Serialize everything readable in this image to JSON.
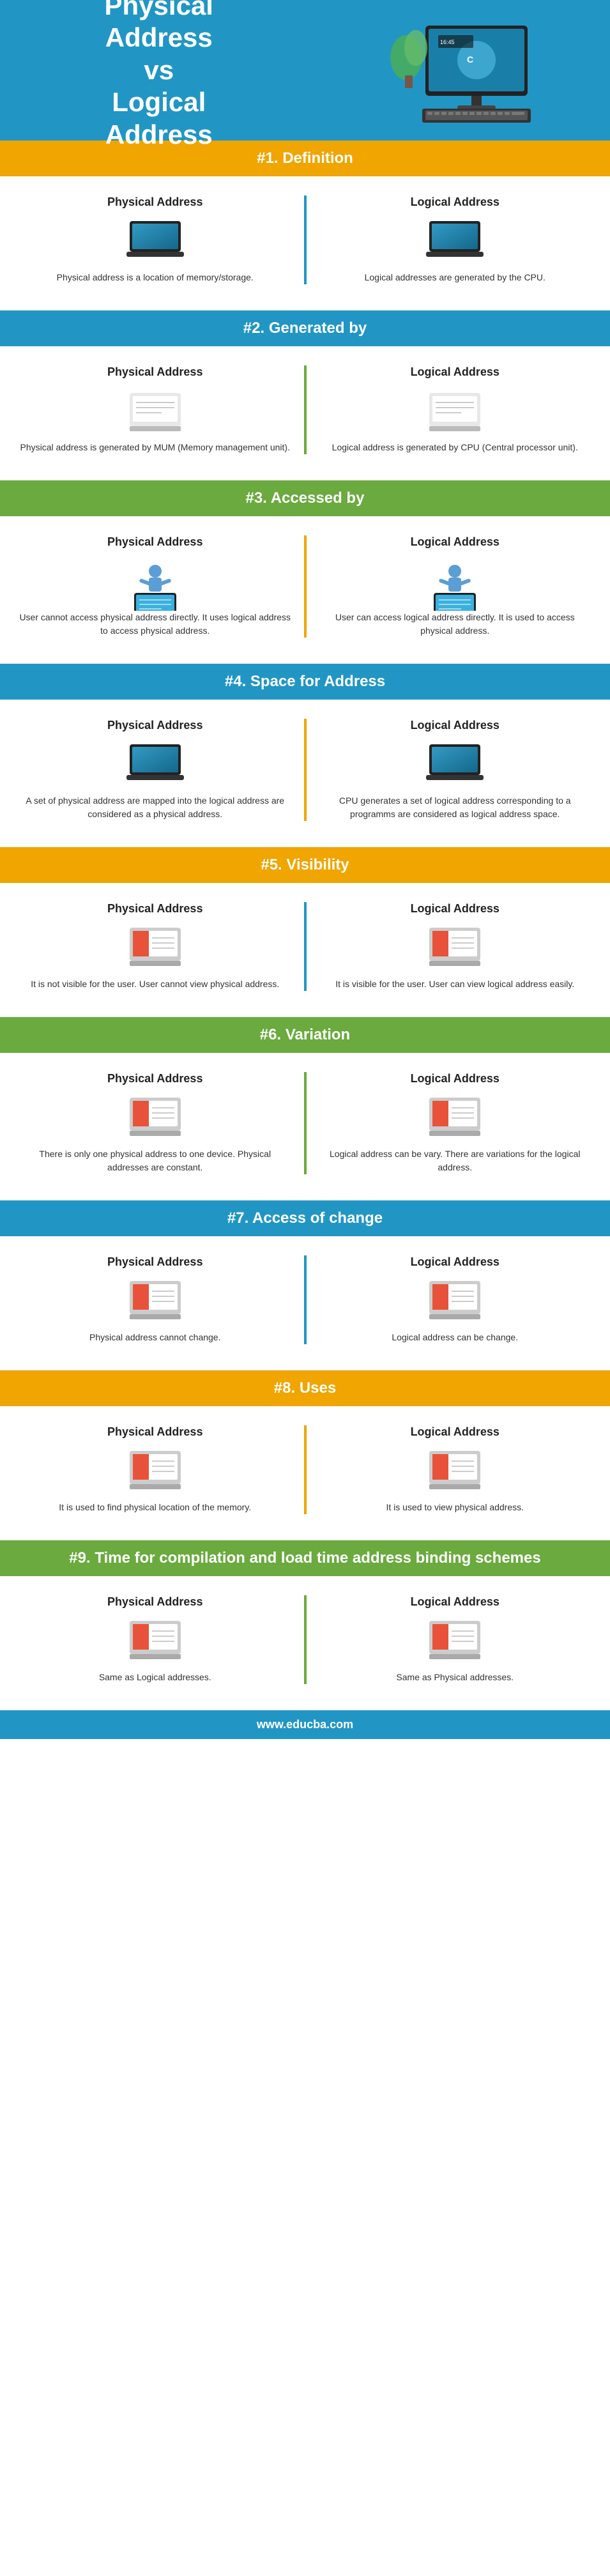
{
  "header": {
    "title_line1": "Physical",
    "title_line2": "Address",
    "title_line3": "vs",
    "title_line4": "Logical",
    "title_line5": "Address"
  },
  "sections": [
    {
      "id": "s1",
      "number": "#1.",
      "title": "Definition",
      "header_color": "orange",
      "divider_color": "blue-div",
      "physical": {
        "title": "Physical Address",
        "icon": "laptop",
        "text": "Physical address is a location of memory/storage."
      },
      "logical": {
        "title": "Logical Address",
        "icon": "laptop",
        "text": "Logical addresses are generated by the CPU."
      }
    },
    {
      "id": "s2",
      "number": "#2.",
      "title": "Generated by",
      "header_color": "blue",
      "divider_color": "green-div",
      "physical": {
        "title": "Physical Address",
        "icon": "doc-laptop",
        "text": "Physical address is generated by MUM (Memory management unit)."
      },
      "logical": {
        "title": "Logical Address",
        "icon": "doc-laptop",
        "text": "Logical address is generated by CPU (Central processor unit)."
      }
    },
    {
      "id": "s3",
      "number": "#3.",
      "title": "Accessed by",
      "header_color": "green",
      "divider_color": "orange-div",
      "physical": {
        "title": "Physical Address",
        "icon": "person",
        "text": "User cannot access physical address directly. It uses logical address to access physical address."
      },
      "logical": {
        "title": "Logical Address",
        "icon": "person",
        "text": "User can access logical address directly. It is used to access physical address."
      }
    },
    {
      "id": "s4",
      "number": "#4.",
      "title": "Space for Address",
      "header_color": "blue",
      "divider_color": "orange-div",
      "physical": {
        "title": "Physical Address",
        "icon": "laptop",
        "text": "A set of physical address are mapped into the logical address are considered as a physical address."
      },
      "logical": {
        "title": "Logical Address",
        "icon": "laptop",
        "text": "CPU generates a set of logical address corresponding to a programms are considered as logical address space."
      }
    },
    {
      "id": "s5",
      "number": "#5.",
      "title": "Visibility",
      "header_color": "orange",
      "divider_color": "blue-div",
      "physical": {
        "title": "Physical Address",
        "icon": "red-laptop",
        "text": "It is not visible for the user. User cannot view physical address."
      },
      "logical": {
        "title": "Logical Address",
        "icon": "red-laptop",
        "text": "It is visible for the user. User can view logical address easily."
      }
    },
    {
      "id": "s6",
      "number": "#6.",
      "title": "Variation",
      "header_color": "green",
      "divider_color": "green-div",
      "physical": {
        "title": "Physical Address",
        "icon": "red-laptop",
        "text": "There is only one physical address to one device. Physical addresses are constant."
      },
      "logical": {
        "title": "Logical Address",
        "icon": "red-laptop",
        "text": "Logical address can be vary. There are variations for the logical address."
      }
    },
    {
      "id": "s7",
      "number": "#7.",
      "title": "Access of change",
      "header_color": "blue",
      "divider_color": "blue-div",
      "physical": {
        "title": "Physical Address",
        "icon": "red-laptop",
        "text": "Physical address cannot change."
      },
      "logical": {
        "title": "Logical Address",
        "icon": "red-laptop",
        "text": "Logical address can be change."
      }
    },
    {
      "id": "s8",
      "number": "#8.",
      "title": "Uses",
      "header_color": "orange",
      "divider_color": "orange-div",
      "physical": {
        "title": "Physical Address",
        "icon": "red-laptop",
        "text": "It is used to find physical location of the memory."
      },
      "logical": {
        "title": "Logical Address",
        "icon": "red-laptop",
        "text": "It is used to view physical address."
      }
    },
    {
      "id": "s9",
      "number": "#9.",
      "title": "Time for compilation and load time address binding schemes",
      "header_color": "green",
      "divider_color": "green-div",
      "physical": {
        "title": "Physical Address",
        "icon": "red-laptop",
        "text": "Same as Logical addresses."
      },
      "logical": {
        "title": "Logical Address",
        "icon": "red-laptop",
        "text": "Same as Physical addresses."
      }
    }
  ],
  "footer": {
    "url": "www.educba.com"
  }
}
